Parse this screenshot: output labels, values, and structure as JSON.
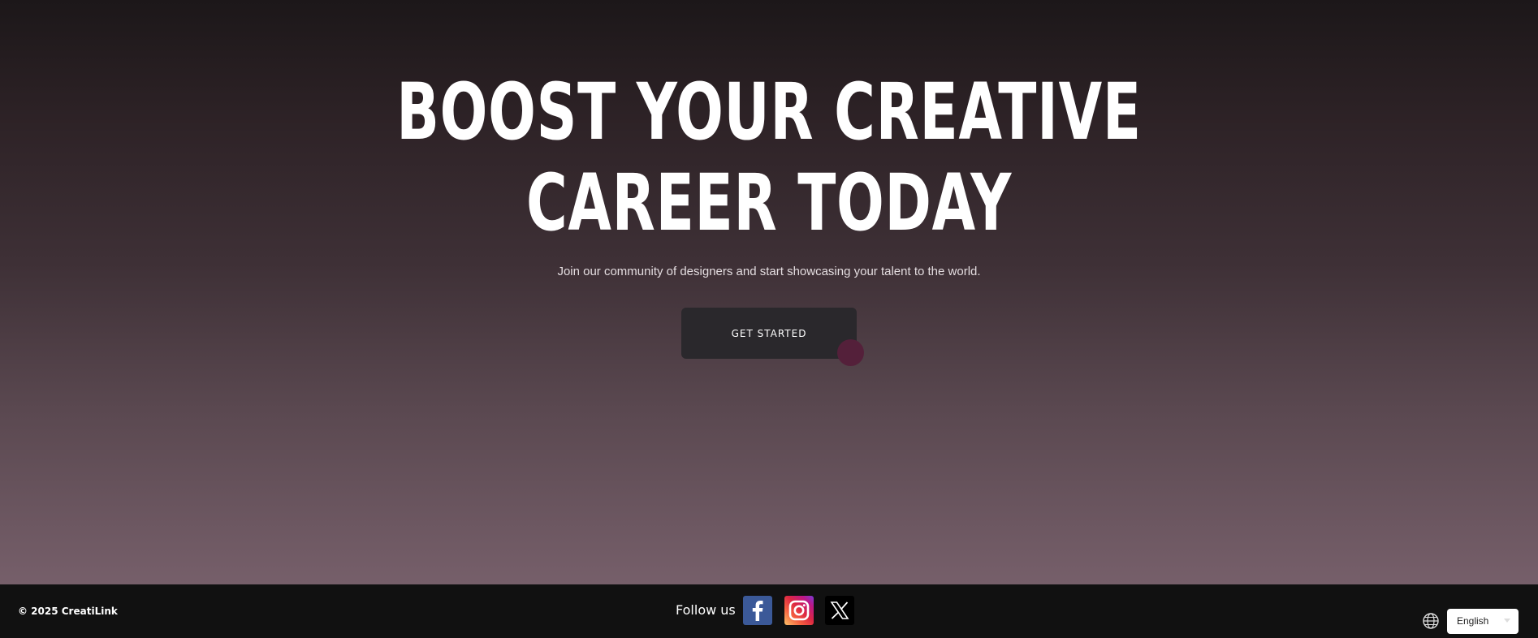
{
  "hero": {
    "headline_line1": "BOOST YOUR CREATIVE",
    "headline_line2": "CAREER TODAY",
    "subtitle": "Join our community of designers and start showcasing your talent to the world.",
    "cta_label": "GET STARTED"
  },
  "footer": {
    "copyright": "© 2025 CreatiLink",
    "follow_label": "Follow us",
    "social": [
      {
        "name": "facebook-icon",
        "color": "#3b5998"
      },
      {
        "name": "instagram-icon",
        "color": "#dc2743"
      },
      {
        "name": "x-icon",
        "color": "#000000"
      }
    ],
    "language": {
      "selected": "English",
      "icon": "globe-icon"
    }
  },
  "colors": {
    "cta_background": "#2a282c",
    "accent_dot": "#54203a",
    "footer_background": "#111111"
  }
}
